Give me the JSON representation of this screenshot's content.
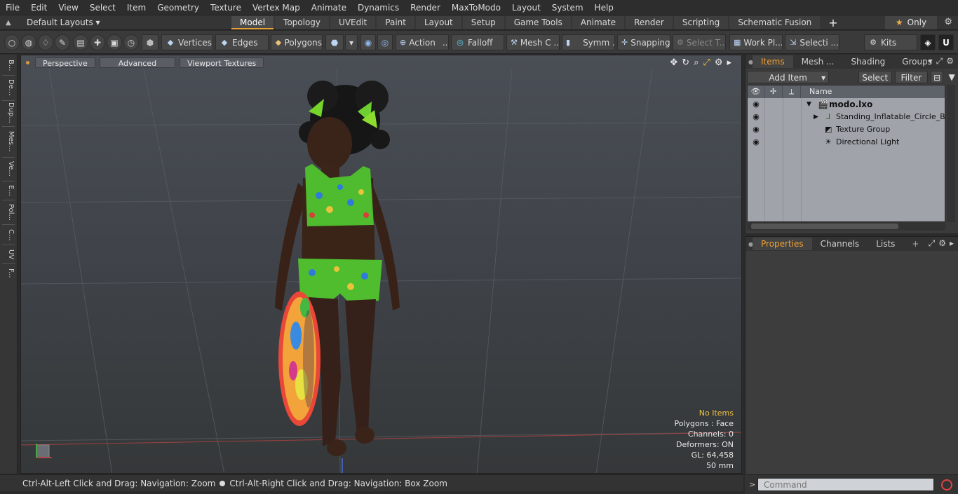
{
  "menu": [
    "File",
    "Edit",
    "View",
    "Select",
    "Item",
    "Geometry",
    "Texture",
    "Vertex Map",
    "Animate",
    "Dynamics",
    "Render",
    "MaxToModo",
    "Layout",
    "System",
    "Help"
  ],
  "layouts": {
    "label": "Default Layouts ▾"
  },
  "tabs": [
    "Model",
    "Topology",
    "UVEdit",
    "Paint",
    "Layout",
    "Setup",
    "Game Tools",
    "Animate",
    "Render",
    "Scripting",
    "Schematic Fusion"
  ],
  "only_label": "Only",
  "toolbar": {
    "vertices": "Vertices",
    "edges": "Edges",
    "polygons": "Polygons",
    "action": "Action",
    "falloff": "Falloff",
    "mesh": "Mesh C ...",
    "symm": "Symm ...",
    "snapping": "Snapping",
    "select_t": "Select T...",
    "workpl": "Work Pl...",
    "selecti": "Selecti ...",
    "kits": "Kits"
  },
  "left_tabs": [
    "B...",
    "De...",
    "Dup...",
    "Mes...",
    "Ve...",
    "E...",
    "Pol...",
    "C...",
    "UV",
    "F..."
  ],
  "viewport": {
    "perspective": "Perspective",
    "advanced": "Advanced",
    "textures": "Viewport Textures",
    "info": {
      "items": "No Items",
      "polygons": "Polygons : Face",
      "channels": "Channels: 0",
      "deformers": "Deformers: ON",
      "gl": "GL: 64,458",
      "size": "50 mm"
    }
  },
  "status": {
    "left": "Ctrl-Alt-Left Click and Drag: Navigation: Zoom",
    "right": "Ctrl-Alt-Right Click and Drag: Navigation: Box Zoom"
  },
  "items_panel": {
    "tabs": [
      "Items",
      "Mesh ...",
      "Shading",
      "Groups"
    ],
    "add_item": "Add Item",
    "select": "Select",
    "filter": "Filter",
    "name_col": "Name",
    "rows": [
      "modo.lxo",
      "Standing_Inflatable_Circle_Bl ...",
      "Texture Group",
      "Directional Light"
    ]
  },
  "props_panel": {
    "tabs": [
      "Properties",
      "Channels",
      "Lists"
    ]
  },
  "command": {
    "placeholder": "Command"
  },
  "colors": {
    "accent": "#e8a03a",
    "warn": "#f0c040"
  }
}
